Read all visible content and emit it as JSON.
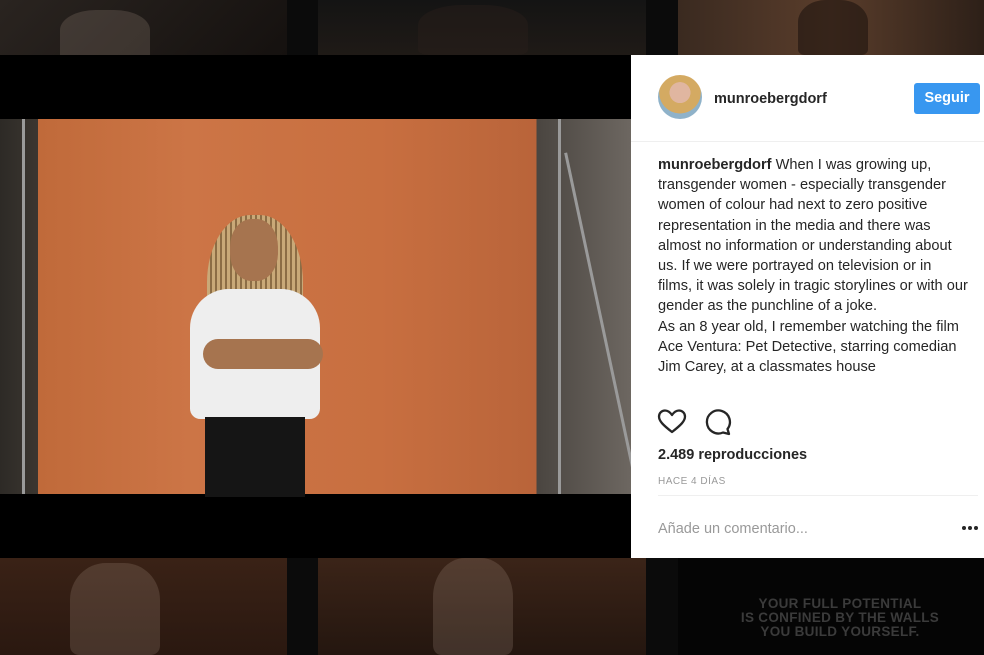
{
  "post": {
    "username": "munroebergdorf",
    "follow_label": "Seguir",
    "caption_user": "munroebergdorf",
    "caption_text_1": "When I was growing up, transgender women - especially transgender women of colour had next to zero positive representation in the media and there was almost no information or understanding about us. If we were portrayed on television or in films, it was solely in tragic storylines or with our gender as the punchline of a joke.",
    "caption_text_2": "As an 8 year old, I remember watching the film Ace Ventura: Pet Detective, starring comedian Jim Carey, at a classmates house",
    "views": "2.489 reproducciones",
    "timestamp": "HACE 4 DÍAS",
    "comment_placeholder": "Añade un comentario...",
    "icons": [
      "heart-icon",
      "comment-icon",
      "more-options-icon"
    ]
  },
  "background": {
    "quote_lines": [
      "YOUR FULL POTENTIAL",
      "IS CONFINED BY THE WALLS",
      "YOU BUILD YOURSELF."
    ]
  },
  "colors": {
    "accent": "#3897f0",
    "text": "#262626",
    "muted": "#999999",
    "backdrop": "#c8703f"
  }
}
